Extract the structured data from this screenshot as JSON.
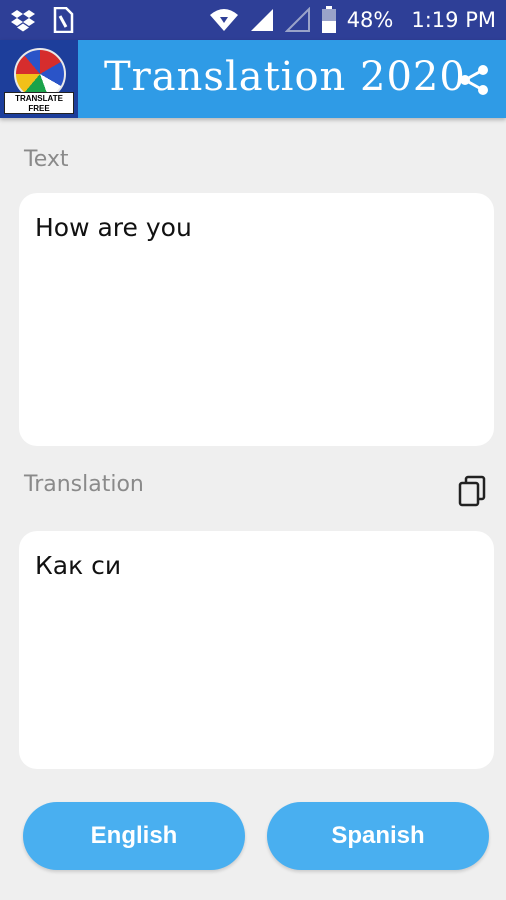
{
  "status_bar": {
    "battery": "48%",
    "time": "1:19 PM"
  },
  "app_bar": {
    "title": "Translation 2020",
    "logo_text": "TRANSLATE FREE"
  },
  "source": {
    "label": "Text",
    "value": "How are you"
  },
  "target": {
    "label": "Translation",
    "value": "Как си"
  },
  "buttons": {
    "from_language": "English",
    "to_language": "Spanish"
  },
  "icons": [
    "dropbox-icon",
    "sim-icon",
    "wifi-icon",
    "signal-icon",
    "battery-icon",
    "share-icon",
    "copy-icon"
  ],
  "colors": {
    "status_bar": "#2e3f97",
    "app_bar": "#2f9be6",
    "button": "#49aff0",
    "background": "#efefef"
  }
}
